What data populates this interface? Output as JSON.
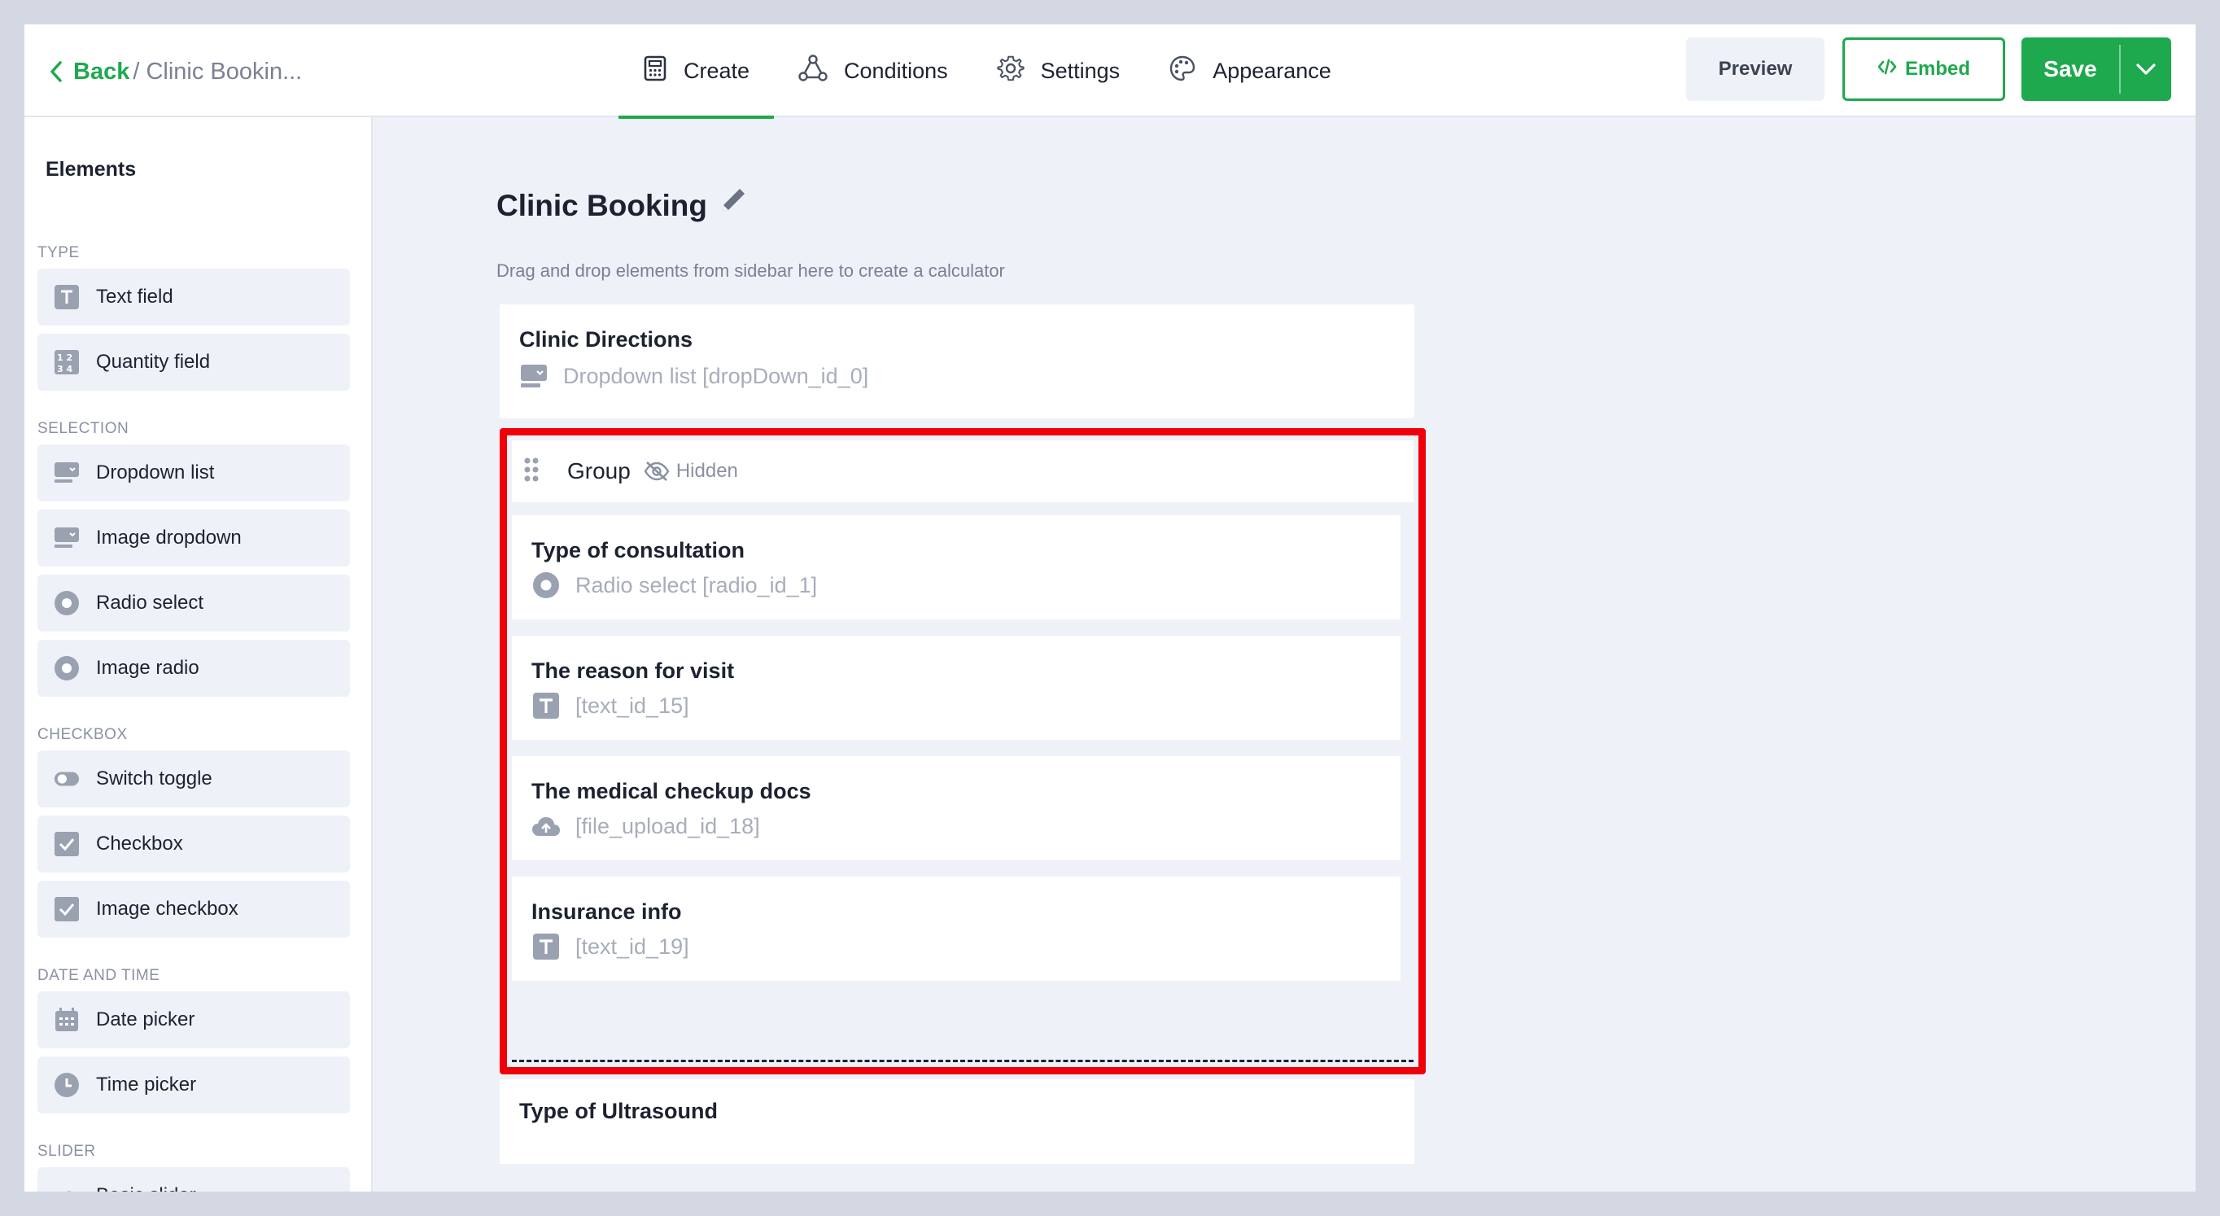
{
  "header": {
    "back_label": "Back",
    "breadcrumb": "/ Clinic Bookin...",
    "tabs": [
      {
        "label": "Create",
        "icon": "calculator-icon",
        "active": true
      },
      {
        "label": "Conditions",
        "icon": "conditions-icon",
        "active": false
      },
      {
        "label": "Settings",
        "icon": "gear-icon",
        "active": false
      },
      {
        "label": "Appearance",
        "icon": "palette-icon",
        "active": false
      }
    ],
    "preview_label": "Preview",
    "embed_label": "Embed",
    "save_label": "Save"
  },
  "sidebar": {
    "title": "Elements",
    "sections": [
      {
        "label": "TYPE",
        "items": [
          {
            "label": "Text field",
            "icon": "text-field-icon"
          },
          {
            "label": "Quantity field",
            "icon": "quantity-icon"
          }
        ]
      },
      {
        "label": "SELECTION",
        "items": [
          {
            "label": "Dropdown list",
            "icon": "dropdown-icon"
          },
          {
            "label": "Image dropdown",
            "icon": "image-dropdown-icon"
          },
          {
            "label": "Radio select",
            "icon": "radio-icon"
          },
          {
            "label": "Image radio",
            "icon": "image-radio-icon"
          }
        ]
      },
      {
        "label": "CHECKBOX",
        "items": [
          {
            "label": "Switch toggle",
            "icon": "toggle-icon"
          },
          {
            "label": "Checkbox",
            "icon": "checkbox-icon"
          },
          {
            "label": "Image checkbox",
            "icon": "image-checkbox-icon"
          }
        ]
      },
      {
        "label": "DATE AND TIME",
        "items": [
          {
            "label": "Date picker",
            "icon": "calendar-icon"
          },
          {
            "label": "Time picker",
            "icon": "clock-icon"
          }
        ]
      },
      {
        "label": "SLIDER",
        "items": [
          {
            "label": "Basic slider",
            "icon": "slider-icon"
          }
        ]
      }
    ]
  },
  "canvas": {
    "title": "Clinic Booking",
    "hint": "Drag and drop elements from sidebar here to create a calculator",
    "directions": {
      "title": "Clinic Directions",
      "sub": "Dropdown list  [dropDown_id_0]"
    },
    "group": {
      "label": "Group",
      "hidden_label": "Hidden",
      "items": [
        {
          "title": "Type of consultation",
          "sub": "Radio select  [radio_id_1]",
          "icon": "radio-icon"
        },
        {
          "title": "The reason for visit",
          "sub": "[text_id_15]",
          "icon": "text-field-icon"
        },
        {
          "title": "The medical checkup docs",
          "sub": "[file_upload_id_18]",
          "icon": "cloud-upload-icon"
        },
        {
          "title": "Insurance info",
          "sub": "[text_id_19]",
          "icon": "text-field-icon"
        }
      ]
    },
    "ultrasound": {
      "title": "Type of Ultrasound"
    }
  },
  "colors": {
    "accent": "#1fa94e",
    "highlight": "#f0000a",
    "muted": "#a7adbb"
  }
}
